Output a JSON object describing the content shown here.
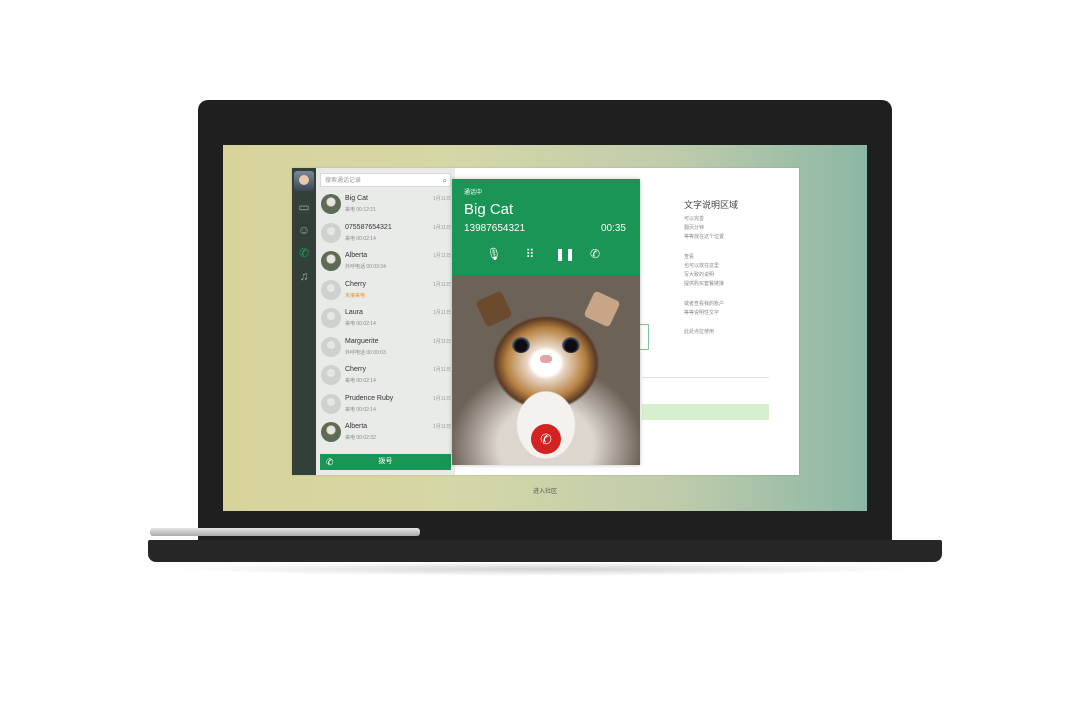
{
  "sidebar": {
    "icons": [
      "avatar",
      "chat-icon",
      "contacts-icon",
      "phone-icon",
      "bell-icon"
    ]
  },
  "search": {
    "placeholder": "搜索通话记录"
  },
  "calls": [
    {
      "name": "Big Cat",
      "sub": "来电",
      "time": "00:12:21",
      "date": "1月11日",
      "photo": true
    },
    {
      "name": "07558765432​1",
      "sub": "来电",
      "time": "00:02:14",
      "date": "1月11日",
      "photo": false
    },
    {
      "name": "Alberta",
      "sub": "外呼电话",
      "time": "00:03:34",
      "date": "1月11日",
      "photo": true
    },
    {
      "name": "Cherry",
      "sub": "未接来电",
      "time": "",
      "date": "1月11日",
      "photo": false,
      "missed": true
    },
    {
      "name": "Laura",
      "sub": "来电",
      "time": "00:02:14",
      "date": "1月11日",
      "photo": false
    },
    {
      "name": "Marguerite",
      "sub": "外呼电话",
      "time": "00:00:03",
      "date": "1月11日",
      "photo": false
    },
    {
      "name": "Cherry",
      "sub": "来电",
      "time": "00:02:14",
      "date": "1月11日",
      "photo": false
    },
    {
      "name": "Prudence Ruby",
      "sub": "来电",
      "time": "00:02:14",
      "date": "1月11日",
      "photo": false
    },
    {
      "name": "Alberta",
      "sub": "来电",
      "time": "00:02:32",
      "date": "1月11日",
      "photo": true
    }
  ],
  "dial": {
    "label": "拨号"
  },
  "call": {
    "status": "通话中",
    "name": "Big Cat",
    "number": "13987654321",
    "timer": "00:35",
    "controls": [
      "mute-icon",
      "keypad-icon",
      "pause-icon",
      "add-call-icon"
    ]
  },
  "description": {
    "title": "文字说明区域",
    "lines": [
      "可以完善",
      "翻页分钟",
      "等等放在这个位置",
      "查看",
      "也可以放在这里",
      "写大致的说明",
      "提供购买套餐链接",
      "或者查看我的账户",
      "等等说明性文字",
      "此处点拉使用"
    ]
  },
  "footer": {
    "link": "进入社区"
  }
}
